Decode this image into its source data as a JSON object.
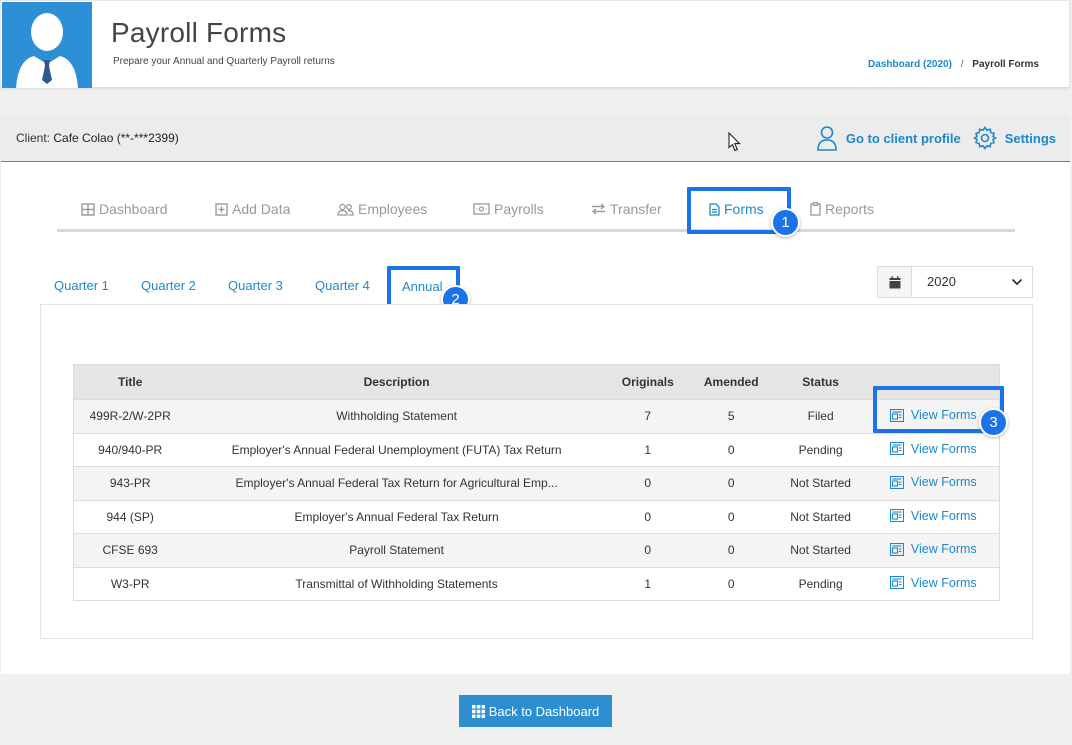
{
  "header": {
    "title": "Payroll Forms",
    "subtitle": "Prepare your Annual and Quarterly Payroll returns",
    "breadcrumb": {
      "link": "Dashboard (2020)",
      "separator": "/",
      "current": "Payroll Forms"
    }
  },
  "client_bar": {
    "label": "Client:",
    "name": "Cafe Colao (**-***2399)",
    "profile_link": "Go to client profile",
    "settings_link": "Settings"
  },
  "nav": {
    "items": [
      {
        "label": "Dashboard",
        "icon": "grid-icon"
      },
      {
        "label": "Add Data",
        "icon": "plus-square-icon"
      },
      {
        "label": "Employees",
        "icon": "users-icon"
      },
      {
        "label": "Payrolls",
        "icon": "money-icon"
      },
      {
        "label": "Transfer",
        "icon": "exchange-icon"
      },
      {
        "label": "Forms",
        "icon": "file-icon"
      },
      {
        "label": "Reports",
        "icon": "clipboard-icon"
      }
    ],
    "active": "Forms"
  },
  "callouts": [
    "1",
    "2",
    "3"
  ],
  "period_tabs": [
    "Quarter 1",
    "Quarter 2",
    "Quarter 3",
    "Quarter 4",
    "Annual"
  ],
  "year_select": {
    "value": "2020"
  },
  "table": {
    "columns": [
      "Title",
      "Description",
      "Originals",
      "Amended",
      "Status",
      ""
    ],
    "rows": [
      {
        "title": "499R-2/W-2PR",
        "description": "Withholding Statement",
        "originals": "7",
        "amended": "5",
        "status": "Filed",
        "action": "View Forms"
      },
      {
        "title": "940/940-PR",
        "description": "Employer's Annual Federal Unemployment (FUTA) Tax Return",
        "originals": "1",
        "amended": "0",
        "status": "Pending",
        "action": "View Forms"
      },
      {
        "title": "943-PR",
        "description": "Employer's Annual Federal Tax Return for Agricultural Emp...",
        "originals": "0",
        "amended": "0",
        "status": "Not Started",
        "action": "View Forms"
      },
      {
        "title": "944 (SP)",
        "description": "Employer's Annual Federal Tax Return",
        "originals": "0",
        "amended": "0",
        "status": "Not Started",
        "action": "View Forms"
      },
      {
        "title": "CFSE 693",
        "description": "Payroll Statement",
        "originals": "0",
        "amended": "0",
        "status": "Not Started",
        "action": "View Forms"
      },
      {
        "title": "W3-PR",
        "description": "Transmittal of Withholding Statements",
        "originals": "1",
        "amended": "0",
        "status": "Pending",
        "action": "View Forms"
      }
    ]
  },
  "footer": {
    "back_button": "Back to Dashboard"
  },
  "colors": {
    "accent": "#1e88c8",
    "highlight": "#1a73e8",
    "avatar_bg": "#2d8fd5"
  }
}
